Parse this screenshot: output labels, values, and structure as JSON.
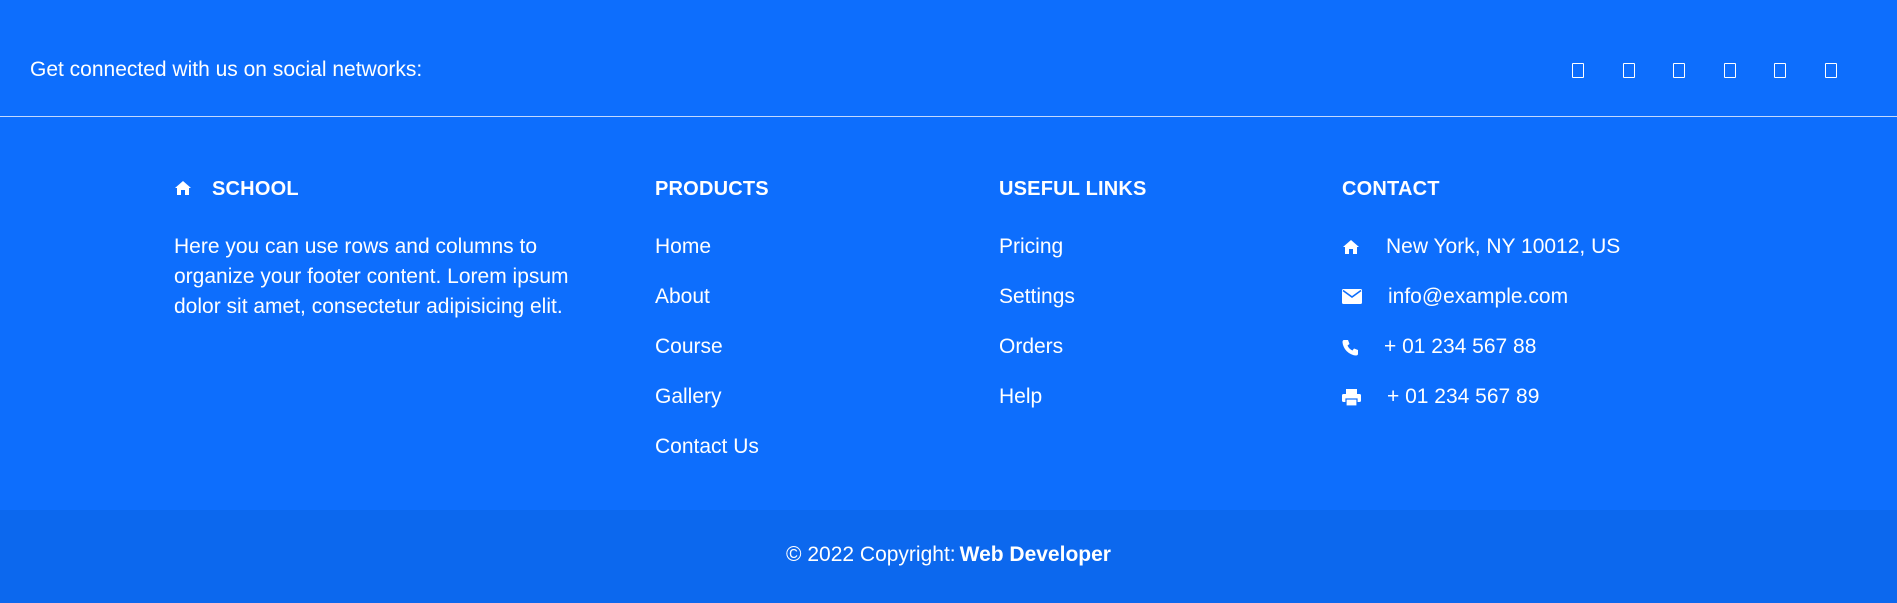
{
  "social": {
    "text": "Get connected with us on social networks:",
    "icons": [
      "facebook-icon",
      "twitter-icon",
      "google-icon",
      "instagram-icon",
      "linkedin-icon",
      "github-icon"
    ]
  },
  "school": {
    "title": "SCHOOL",
    "icon": "home-icon",
    "description": "Here you can use rows and columns to organize your footer content. Lorem ipsum dolor sit amet, consectetur adipisicing elit."
  },
  "products": {
    "title": "PRODUCTS",
    "items": [
      "Home",
      "About",
      "Course",
      "Gallery",
      "Contact Us"
    ]
  },
  "useful_links": {
    "title": "USEFUL LINKS",
    "items": [
      "Pricing",
      "Settings",
      "Orders",
      "Help"
    ]
  },
  "contact": {
    "title": "CONTACT",
    "items": [
      {
        "icon": "home-icon",
        "text": "New York, NY 10012, US"
      },
      {
        "icon": "envelope-icon",
        "text": "info@example.com"
      },
      {
        "icon": "phone-icon",
        "text": "+ 01 234 567 88"
      },
      {
        "icon": "print-icon",
        "text": "+ 01 234 567 89"
      }
    ]
  },
  "footer": {
    "copyright_prefix": "© 2022 Copyright:",
    "brand": "Web Developer"
  },
  "colors": {
    "background": "#0d6efd",
    "bottom_bar": "#0c68ee",
    "text": "#ffffff"
  }
}
